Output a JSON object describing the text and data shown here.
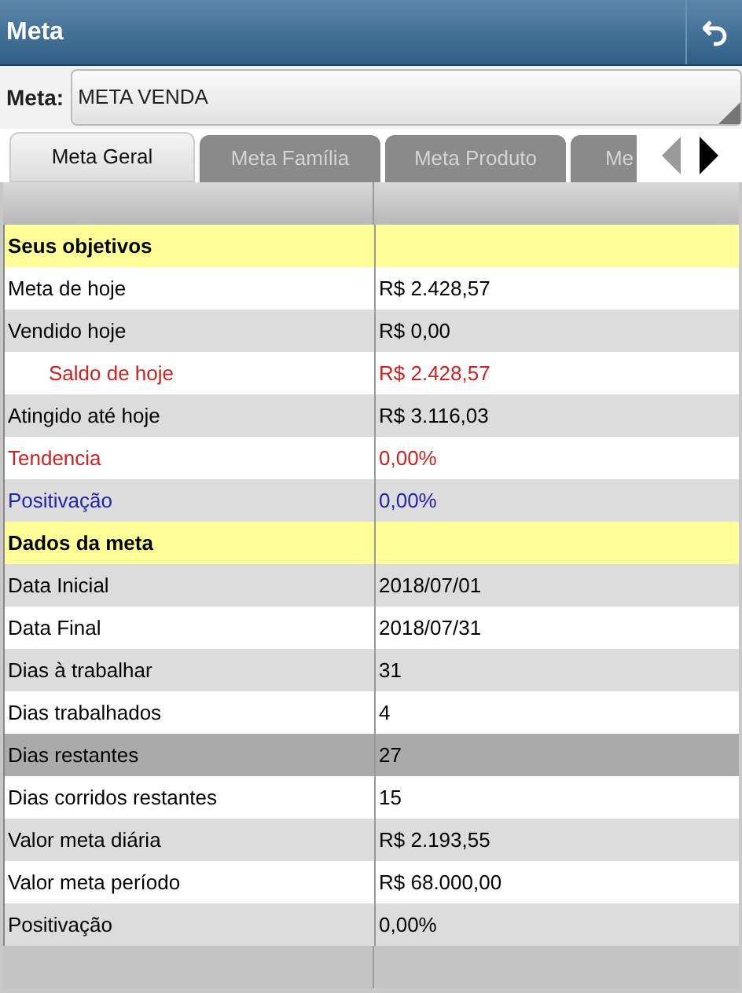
{
  "window": {
    "title": "Meta"
  },
  "meta_field": {
    "label": "Meta:",
    "value": "META VENDA"
  },
  "tabs": [
    {
      "label": "Meta Geral",
      "selected": true
    },
    {
      "label": "Meta Família",
      "selected": false
    },
    {
      "label": "Meta Produto",
      "selected": false
    },
    {
      "label": "Me",
      "selected": false
    }
  ],
  "tab_scroll": {
    "left_disabled": true,
    "right_disabled": false
  },
  "table": {
    "rows": [
      {
        "kind": "section",
        "label": "Seus objetivos"
      },
      {
        "kind": "row",
        "label": "Meta de hoje",
        "value": "R$ 2.428,57",
        "color": "#000000",
        "selected": false
      },
      {
        "kind": "row",
        "label": "Vendido hoje",
        "value": "R$ 0,00",
        "color": "#000000",
        "selected": false,
        "children": [
          {
            "kind": "row",
            "label": "Saldo de hoje",
            "value": "R$ 2.428,57",
            "color": "#cc2222",
            "selected": false
          }
        ]
      },
      {
        "kind": "row",
        "label": "Atingido até hoje",
        "value": "R$ 3.116,03",
        "color": "#000000",
        "selected": false
      },
      {
        "kind": "row",
        "label": "Tendencia",
        "value": "0,00%",
        "color": "#cc2222",
        "selected": false
      },
      {
        "kind": "row",
        "label": "Positivação",
        "value": "0,00%",
        "color": "#2222aa",
        "selected": false
      },
      {
        "kind": "section",
        "label": "Dados da meta"
      },
      {
        "kind": "row",
        "label": "Data Inicial",
        "value": "2018/07/01",
        "color": "#000000",
        "selected": false
      },
      {
        "kind": "row",
        "label": "Data Final",
        "value": "2018/07/31",
        "color": "#000000",
        "selected": false
      },
      {
        "kind": "row",
        "label": "Dias à trabalhar",
        "value": "31",
        "color": "#000000",
        "selected": false
      },
      {
        "kind": "row",
        "label": "Dias trabalhados",
        "value": "4",
        "color": "#000000",
        "selected": false
      },
      {
        "kind": "row",
        "label": "Dias restantes",
        "value": "27",
        "color": "#000000",
        "selected": true
      },
      {
        "kind": "row",
        "label": "Dias corridos restantes",
        "value": "15",
        "color": "#000000",
        "selected": false
      },
      {
        "kind": "row",
        "label": "Valor meta diária",
        "value": "R$ 2.193,55",
        "color": "#000000",
        "selected": false
      },
      {
        "kind": "row",
        "label": "Valor meta período",
        "value": "R$ 68.000,00",
        "color": "#000000",
        "selected": false
      },
      {
        "kind": "row",
        "label": "Positivação",
        "value": "0,00%",
        "color": "#000000",
        "selected": false
      }
    ]
  }
}
